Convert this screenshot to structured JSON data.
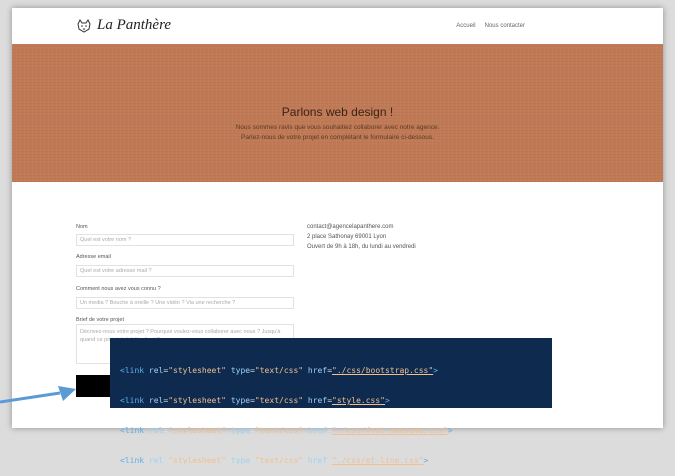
{
  "navbar": {
    "logo_text": "La Panthère",
    "links": [
      "Accueil",
      "Nous contacter"
    ]
  },
  "hero": {
    "title": "Parlons web design !",
    "subtitle_line1": "Nous sommes ravis que vous souhaitiez collaborer avec notre agence.",
    "subtitle_line2": "Parlez-nous de votre projet en complétant le formulaire ci-dessous."
  },
  "form": {
    "name_label": "Nom",
    "name_placeholder": "Quel est votre nom ?",
    "email_label": "Adresse email",
    "email_placeholder": "Quel est votre adresse mail ?",
    "source_label": "Comment nous avez vous connu ?",
    "source_placeholder": "Un media ? Bouche à oreille ? Une vidéo ? Via une recherche ?",
    "brief_label": "Brief de votre projet",
    "brief_placeholder": "Décrivez-nous votre projet ? Pourquoi voulez-vous collaborer avec nous ? Jusqu'à quand ce projet doit-il être livré ?"
  },
  "contact": {
    "email": "contact@agencelapanthere.com",
    "address": "2 place Sathonay 69001 Lyon",
    "hours": "Ouvert de 9h à 18h, du lundi au vendredi"
  },
  "code": [
    {
      "tag": "<link",
      "rel": "\"stylesheet\"",
      "type": "\"text/css\"",
      "href": "\"./css/bootstrap.css\""
    },
    {
      "tag": "<link",
      "rel": "\"stylesheet\"",
      "type": "\"text/css\"",
      "href": "\"style.css\""
    },
    {
      "tag": "<link",
      "rel": "\"stylesheet\"",
      "type": "\"text/css\"",
      "href": "\"./css/font-awesome.css\""
    },
    {
      "tag": "<link",
      "rel": "\"stylesheet\"",
      "type": "\"text/css\"",
      "href": "\"./css/et-line.css\""
    }
  ],
  "colors": {
    "hero_background": "#c07a55",
    "code_background": "#0e2a4f",
    "arrow": "#5b9bd5"
  }
}
